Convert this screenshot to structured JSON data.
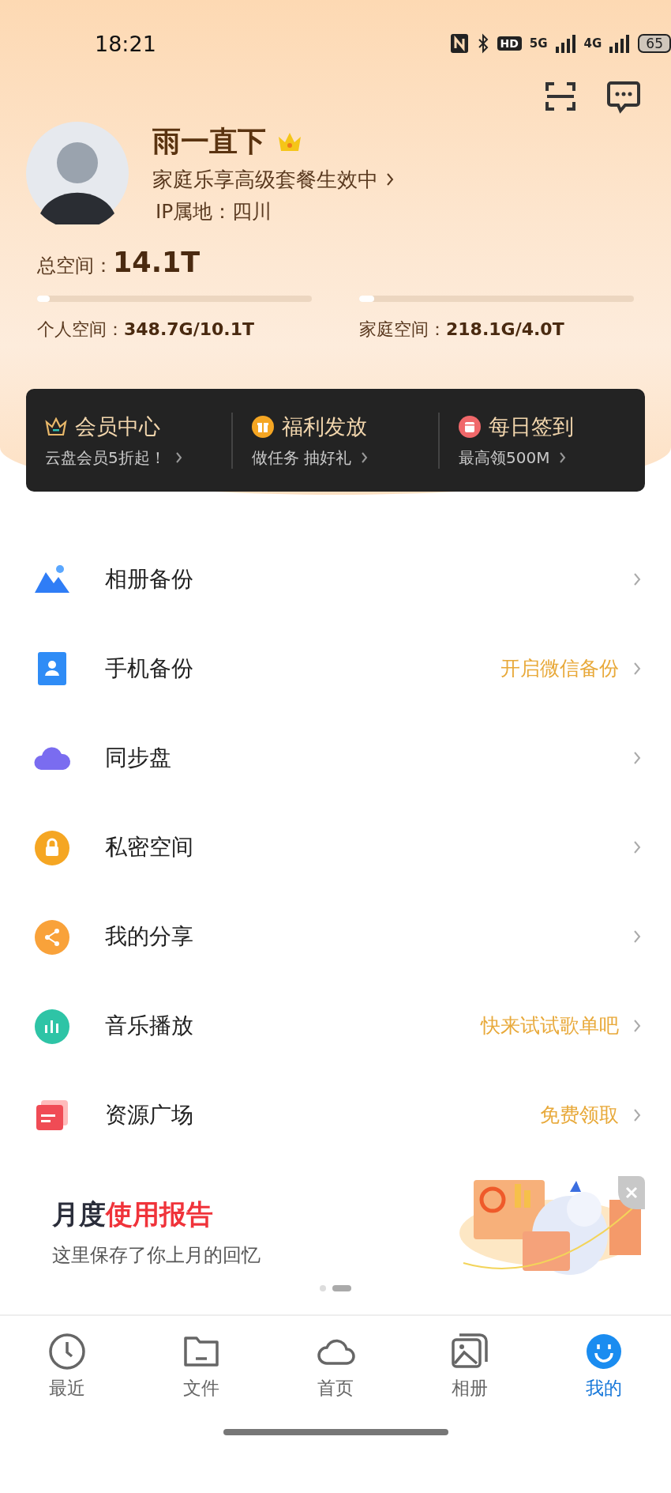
{
  "status_bar": {
    "time": "18:21",
    "hd": "HD",
    "network_1": "5G",
    "network_2": "4G",
    "battery": "65"
  },
  "profile": {
    "name": "雨一直下",
    "vip": true,
    "plan_status": "家庭乐享高级套餐生效中",
    "ip_location": "IP属地：四川"
  },
  "storage": {
    "total_label": "总空间：",
    "total": "14.1T",
    "pools": [
      {
        "label": "个人空间：",
        "value": "348.7G/10.1T",
        "level": 0.035
      },
      {
        "label": "家庭空间：",
        "value": "218.1G/4.0T",
        "level": 0.054
      }
    ]
  },
  "promos": [
    {
      "kind": "crown",
      "title": "会员中心",
      "subtitle": "云盘会员5折起！"
    },
    {
      "kind": "gift",
      "title": "福利发放",
      "subtitle": "做任务 抽好礼"
    },
    {
      "kind": "calendar",
      "title": "每日签到",
      "subtitle": "最高领500M"
    }
  ],
  "menu": [
    {
      "label": "相册备份"
    },
    {
      "kind": "phone",
      "label": "手机备份",
      "hint": "开启微信备份"
    },
    {
      "kind": "cloud",
      "label": "同步盘"
    },
    {
      "kind": "lock",
      "label": "私密空间"
    },
    {
      "kind": "share",
      "label": "我的分享"
    },
    {
      "kind": "music",
      "label": "音乐播放",
      "hint": "快来试试歌单吧"
    },
    {
      "kind": "resource",
      "label": "资源广场",
      "hint": "免费领取"
    }
  ],
  "banner": {
    "title_lead": "月度",
    "title_accent": "使用报告",
    "subtitle": "这里保存了你上月的回忆",
    "kind": "picture",
    "pages": [
      {
        "selected": false
      },
      {
        "selected": true
      }
    ]
  },
  "tabs": [
    {
      "kind": "recent",
      "label": "最近",
      "selected": false
    },
    {
      "kind": "files",
      "label": "文件",
      "selected": false
    },
    {
      "kind": "home",
      "label": "首页",
      "selected": false
    },
    {
      "kind": "album",
      "label": "相册",
      "selected": false
    },
    {
      "kind": "me",
      "label": "我的",
      "selected": true
    }
  ]
}
